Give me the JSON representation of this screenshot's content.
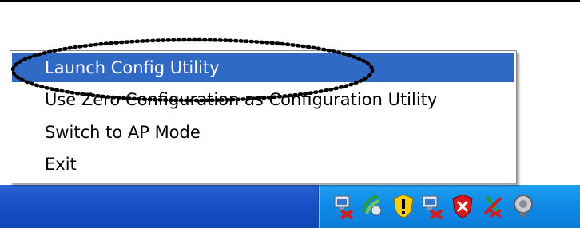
{
  "context_menu": {
    "items": [
      {
        "label": "Launch Config Utility",
        "selected": true
      },
      {
        "label": "Use Zero Configuration as Configuration Utility",
        "selected": false
      },
      {
        "label": "Switch to AP Mode",
        "selected": false
      },
      {
        "label": "Exit",
        "selected": false
      }
    ]
  },
  "tray_icons": [
    "network-disconnected-icon",
    "wireless-utility-icon",
    "security-shield-alert-icon",
    "network-disconnected-icon",
    "security-center-warning-icon",
    "network-error-icon",
    "volume-icon"
  ],
  "colors": {
    "selection": "#316ac5",
    "taskbar": "#1a50c8",
    "tray": "#0e8ae6"
  }
}
